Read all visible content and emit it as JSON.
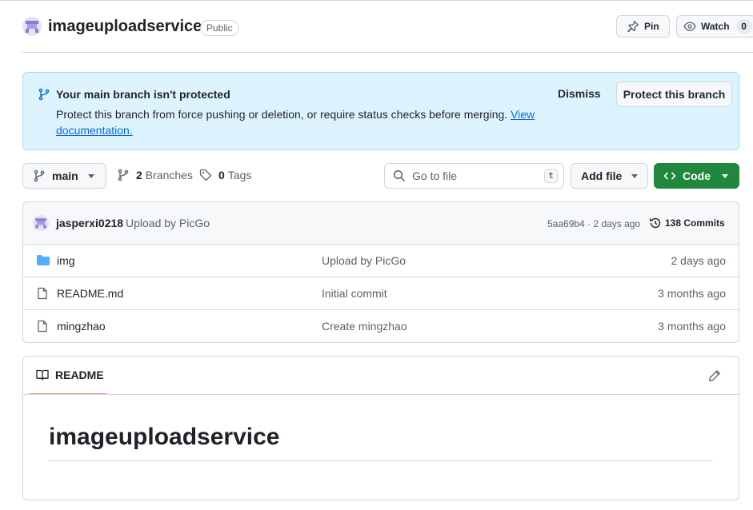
{
  "repo": {
    "name": "imageuploadservice",
    "visibility": "Public",
    "pin_label": "Pin",
    "watch_label": "Watch",
    "watch_count": "0"
  },
  "banner": {
    "title": "Your main branch isn't protected",
    "text": "Protect this branch from force pushing or deletion, or require status checks before merging.",
    "link_text": "View documentation.",
    "dismiss_label": "Dismiss",
    "protect_label": "Protect this branch"
  },
  "toolbar": {
    "branch": "main",
    "branches_count": "2",
    "branches_label": "Branches",
    "tags_count": "0",
    "tags_label": "Tags",
    "goto_placeholder": "Go to file",
    "goto_shortcut": "t",
    "add_file_label": "Add file",
    "code_label": "Code"
  },
  "latest_commit": {
    "author": "jasperxi0218",
    "message": "Upload by PicGo",
    "sha_time": "5aa69b4 · 2 days ago",
    "commits_label": "138 Commits"
  },
  "files": [
    {
      "type": "folder",
      "name": "img",
      "message": "Upload by PicGo",
      "date": "2 days ago"
    },
    {
      "type": "file",
      "name": "README.md",
      "message": "Initial commit",
      "date": "3 months ago"
    },
    {
      "type": "file",
      "name": "mingzhao",
      "message": "Create mingzhao",
      "date": "3 months ago"
    }
  ],
  "readme": {
    "tab_label": "README",
    "heading": "imageuploadservice"
  },
  "colors": {
    "accent_green": "#1f883d",
    "banner_bg": "#ddf4ff",
    "link": "#0969da",
    "folder": "#54aeff",
    "tab_underline": "#fd8c73"
  }
}
